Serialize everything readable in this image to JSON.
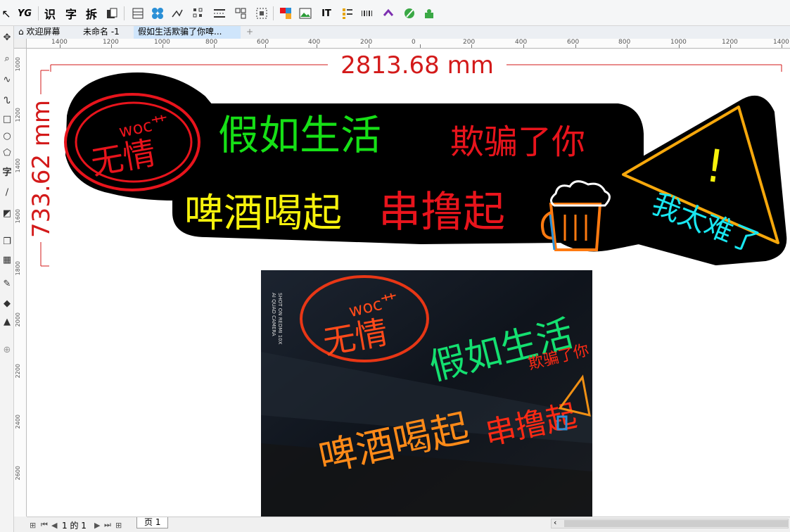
{
  "toolbar": {
    "text_buttons": [
      "识",
      "字",
      "拆"
    ]
  },
  "tabs": [
    {
      "label": "欢迎屏幕"
    },
    {
      "label": "未命名 -1"
    },
    {
      "label": "假如生活欺骗了你啤..."
    }
  ],
  "ruler_h": {
    "ticks": [
      "1400",
      "1200",
      "1000",
      "800",
      "600",
      "400",
      "200",
      "0",
      "200",
      "400",
      "600",
      "800",
      "1000",
      "1200",
      "1400"
    ]
  },
  "ruler_v": {
    "ticks": [
      "1000",
      "1200",
      "1400",
      "1600",
      "1800",
      "2000",
      "2200",
      "2400",
      "2600"
    ]
  },
  "dimensions": {
    "width": "2813.68 mm",
    "height": "733.62 mm"
  },
  "sign": {
    "badge_top": "woc艹",
    "badge_main": "无情",
    "line1_green": "假如生活",
    "line1_red": "欺骗了你",
    "line2_yellow": "啤酒喝起",
    "line2_red": "串撸起",
    "triangle_text": "我太难了",
    "exclaim": "!"
  },
  "photo": {
    "watermark": "SHOT ON REDMI 10X\nAI QUAD CAMERA",
    "badge_top": "woc艹",
    "badge_main": "无情",
    "line1_green": "假如生活",
    "line1_red": "欺骗了你",
    "line2_orange": "啤酒喝起",
    "line2_red": "串撸起"
  },
  "status": {
    "page_count": "1 的 1",
    "page_tab": "页 1"
  },
  "colors": {
    "neon_red": "#e8141c",
    "neon_green": "#16e016",
    "neon_yellow": "#f6f20c",
    "neon_cyan": "#19e6f0",
    "neon_orange": "#ff7a10",
    "dim_red": "#d31a1a"
  }
}
